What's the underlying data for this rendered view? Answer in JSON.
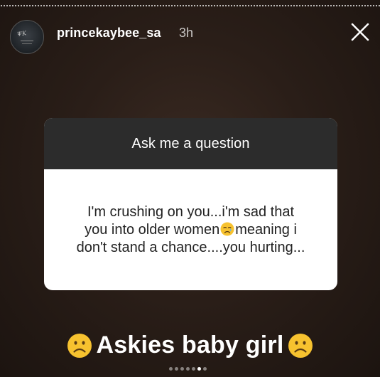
{
  "header": {
    "username": "princekaybee_sa",
    "timestamp": "3h"
  },
  "card": {
    "title": "Ask me a question",
    "question_lines": [
      "I'm crushing on you...i'm sad that",
      "you into older women",
      "meaning i",
      "don't stand a chance....you hurting..."
    ],
    "inline_emoji": "crying-face-icon"
  },
  "caption": {
    "text": "Askies baby girl",
    "emoji": "frowning-face-icon"
  },
  "pagination": {
    "total": 7,
    "active_index": 5
  },
  "colors": {
    "card_header": "#2c2c2c",
    "card_body": "#ffffff",
    "emoji_yellow": "#f7c22f",
    "background": "#2a1e18"
  }
}
